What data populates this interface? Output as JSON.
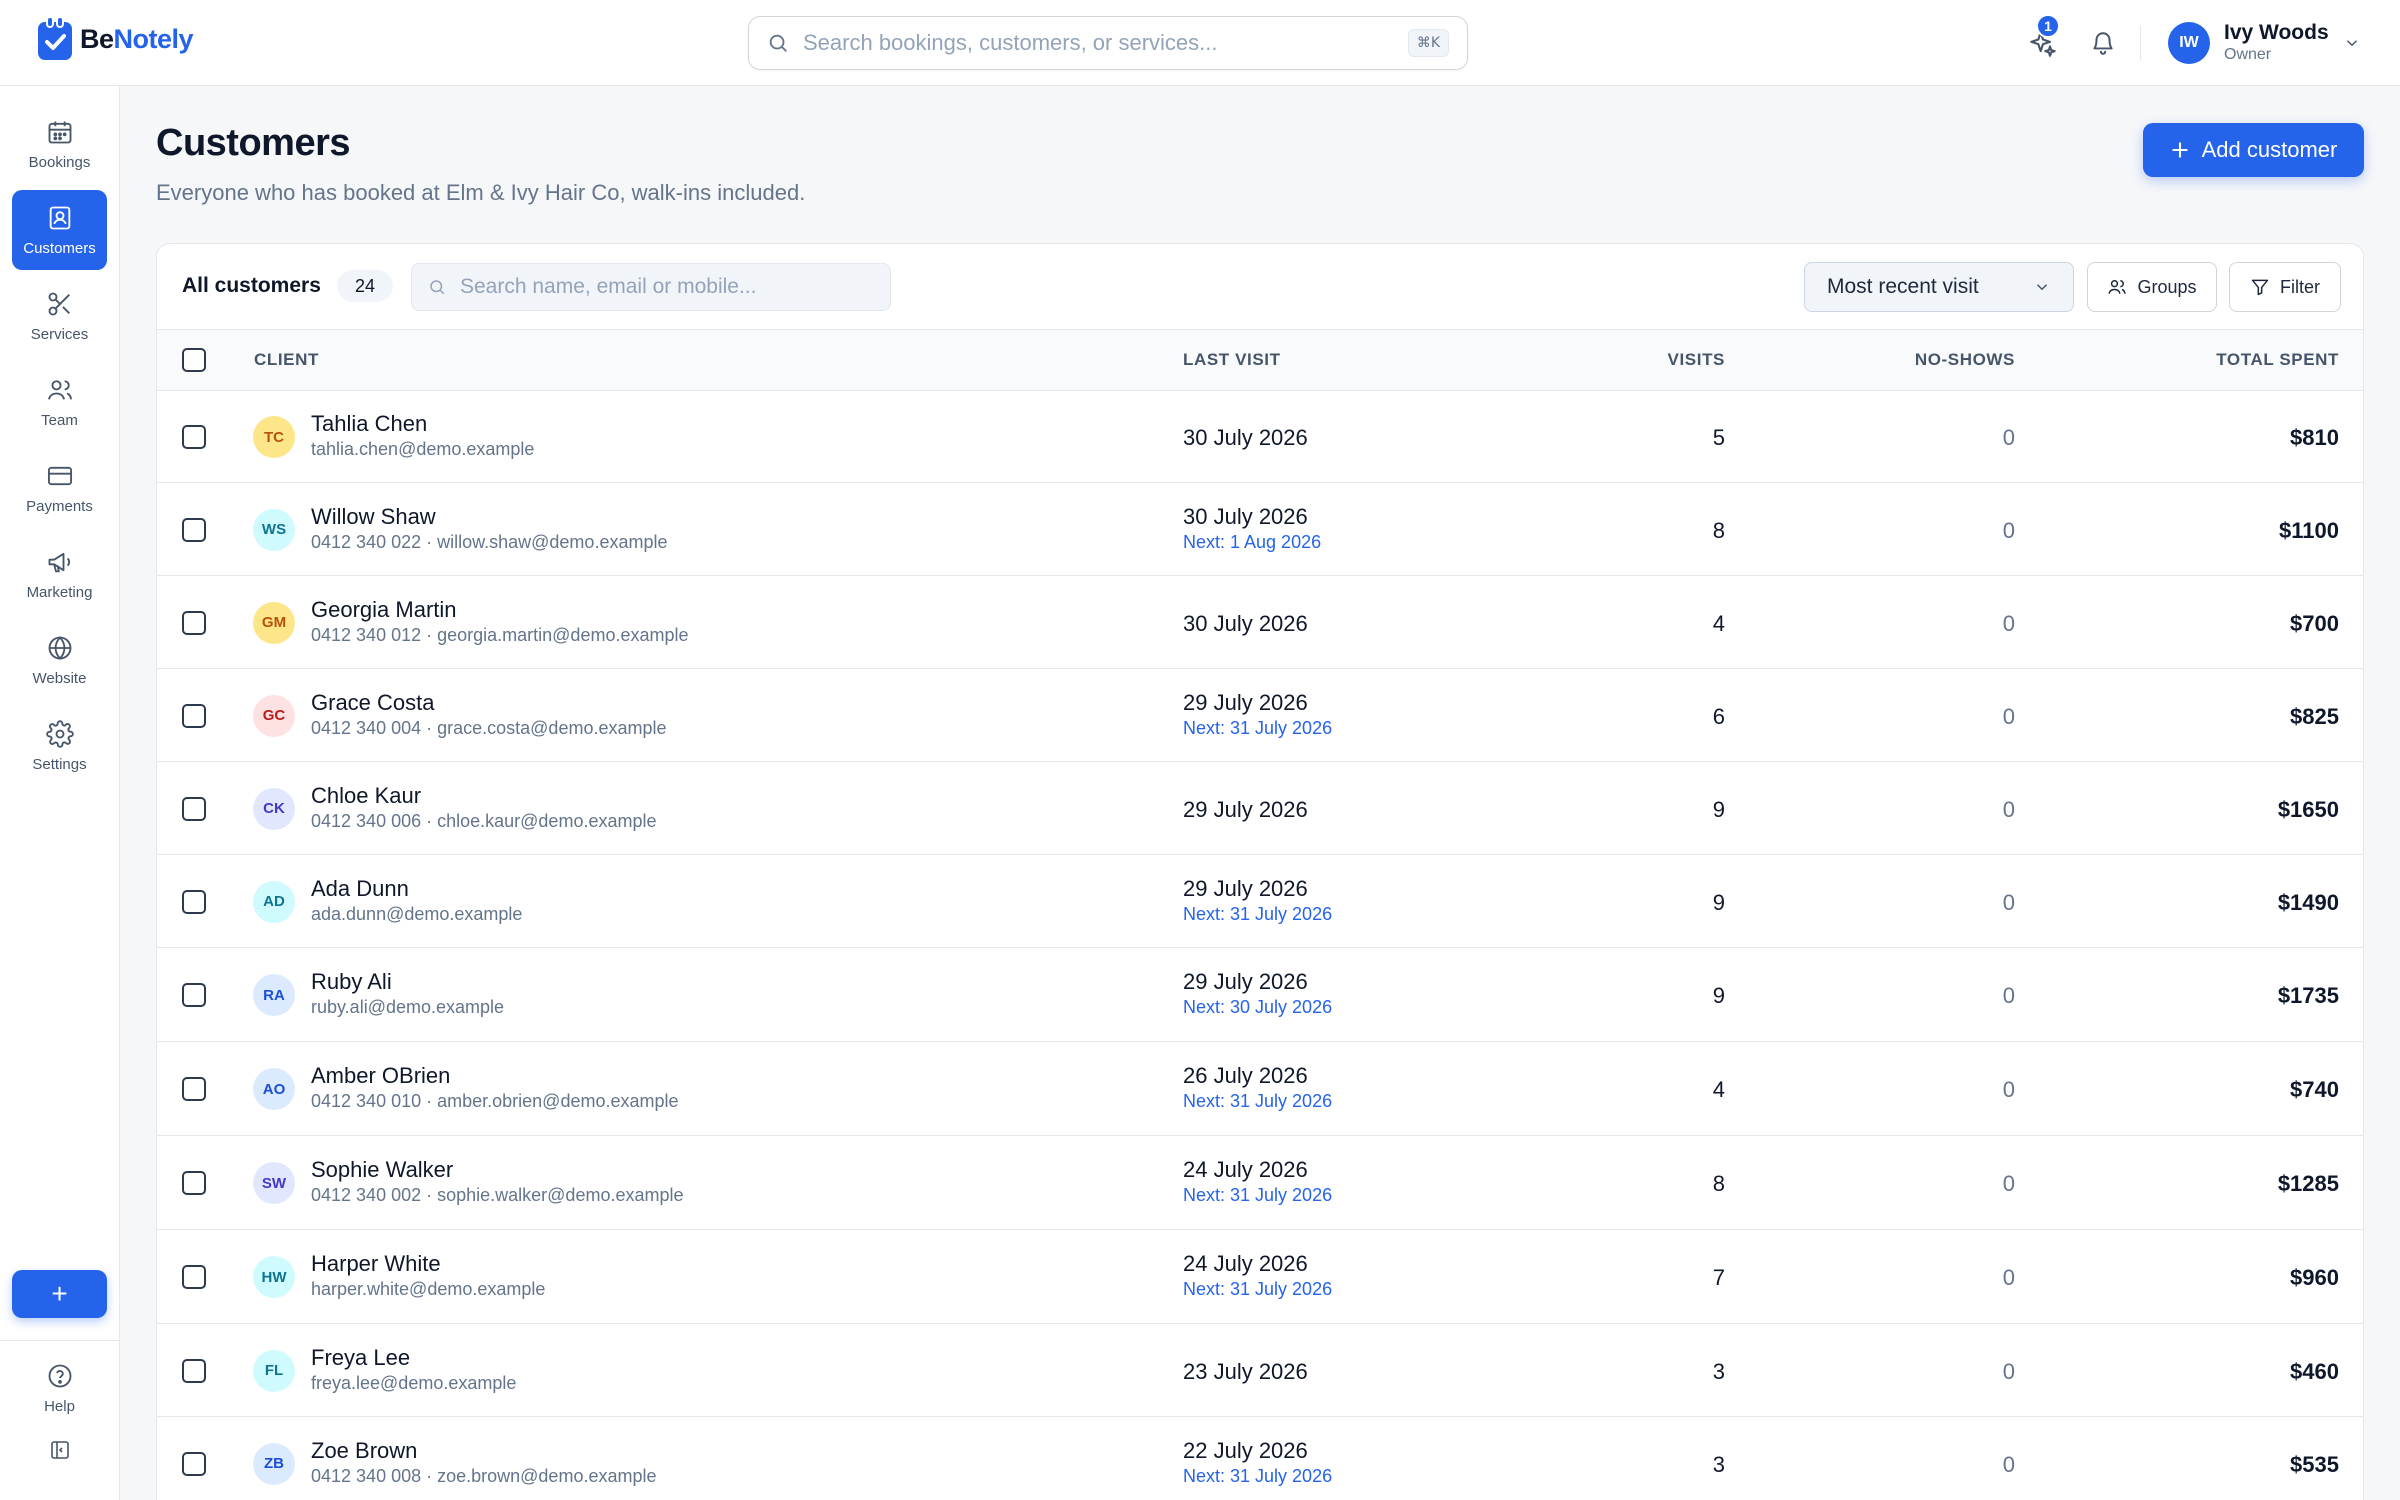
{
  "brand": {
    "name_part1": "Be",
    "name_part2": "Notely"
  },
  "search": {
    "placeholder": "Search bookings, customers, or services...",
    "shortcut": "⌘K"
  },
  "notifications": {
    "count": "1"
  },
  "user": {
    "initials": "IW",
    "name": "Ivy Woods",
    "role": "Owner"
  },
  "sidebar": {
    "items": [
      {
        "label": "Bookings",
        "icon": "calendar-icon"
      },
      {
        "label": "Customers",
        "icon": "contact-card-icon",
        "active": true
      },
      {
        "label": "Services",
        "icon": "scissors-icon"
      },
      {
        "label": "Team",
        "icon": "users-icon"
      },
      {
        "label": "Payments",
        "icon": "credit-card-icon"
      },
      {
        "label": "Marketing",
        "icon": "megaphone-icon"
      },
      {
        "label": "Website",
        "icon": "globe-icon"
      },
      {
        "label": "Settings",
        "icon": "gear-icon"
      }
    ],
    "fab_label": "+",
    "help_label": "Help"
  },
  "page": {
    "title": "Customers",
    "subtitle": "Everyone who has booked at Elm & Ivy Hair Co, walk-ins included.",
    "add_button": "Add customer"
  },
  "table_toolbar": {
    "all_label": "All customers",
    "count": "24",
    "search_placeholder": "Search name, email or mobile...",
    "sort_value": "Most recent visit",
    "groups_label": "Groups",
    "filter_label": "Filter"
  },
  "columns": {
    "client": "CLIENT",
    "last_visit": "LAST VISIT",
    "visits": "VISITS",
    "no_shows": "NO-SHOWS",
    "total_spent": "TOTAL SPENT"
  },
  "accent_color": "#2563eb",
  "customers": [
    {
      "initials": "TC",
      "name": "Tahlia Chen",
      "contact": "tahlia.chen@demo.example",
      "last_visit": "30 July 2026",
      "next": "",
      "visits": "5",
      "no_shows": "0",
      "total": "$810",
      "avatar_bg": "#fde68a",
      "avatar_fg": "#b45309"
    },
    {
      "initials": "WS",
      "name": "Willow Shaw",
      "contact": "0412 340 022 · willow.shaw@demo.example",
      "last_visit": "30 July 2026",
      "next": "Next: 1 Aug 2026",
      "visits": "8",
      "no_shows": "0",
      "total": "$1100",
      "avatar_bg": "#cffafe",
      "avatar_fg": "#0e7490"
    },
    {
      "initials": "GM",
      "name": "Georgia Martin",
      "contact": "0412 340 012 · georgia.martin@demo.example",
      "last_visit": "30 July 2026",
      "next": "",
      "visits": "4",
      "no_shows": "0",
      "total": "$700",
      "avatar_bg": "#fde68a",
      "avatar_fg": "#b45309"
    },
    {
      "initials": "GC",
      "name": "Grace Costa",
      "contact": "0412 340 004 · grace.costa@demo.example",
      "last_visit": "29 July 2026",
      "next": "Next: 31 July 2026",
      "visits": "6",
      "no_shows": "0",
      "total": "$825",
      "avatar_bg": "#fee2e2",
      "avatar_fg": "#b91c1c"
    },
    {
      "initials": "CK",
      "name": "Chloe Kaur",
      "contact": "0412 340 006 · chloe.kaur@demo.example",
      "last_visit": "29 July 2026",
      "next": "",
      "visits": "9",
      "no_shows": "0",
      "total": "$1650",
      "avatar_bg": "#e0e7ff",
      "avatar_fg": "#4338ca"
    },
    {
      "initials": "AD",
      "name": "Ada Dunn",
      "contact": "ada.dunn@demo.example",
      "last_visit": "29 July 2026",
      "next": "Next: 31 July 2026",
      "visits": "9",
      "no_shows": "0",
      "total": "$1490",
      "avatar_bg": "#cffafe",
      "avatar_fg": "#0e7490"
    },
    {
      "initials": "RA",
      "name": "Ruby Ali",
      "contact": "ruby.ali@demo.example",
      "last_visit": "29 July 2026",
      "next": "Next: 30 July 2026",
      "visits": "9",
      "no_shows": "0",
      "total": "$1735",
      "avatar_bg": "#dbeafe",
      "avatar_fg": "#1d4ed8"
    },
    {
      "initials": "AO",
      "name": "Amber OBrien",
      "contact": "0412 340 010 · amber.obrien@demo.example",
      "last_visit": "26 July 2026",
      "next": "Next: 31 July 2026",
      "visits": "4",
      "no_shows": "0",
      "total": "$740",
      "avatar_bg": "#dbeafe",
      "avatar_fg": "#1d4ed8"
    },
    {
      "initials": "SW",
      "name": "Sophie Walker",
      "contact": "0412 340 002 · sophie.walker@demo.example",
      "last_visit": "24 July 2026",
      "next": "Next: 31 July 2026",
      "visits": "8",
      "no_shows": "0",
      "total": "$1285",
      "avatar_bg": "#e0e7ff",
      "avatar_fg": "#4338ca"
    },
    {
      "initials": "HW",
      "name": "Harper White",
      "contact": "harper.white@demo.example",
      "last_visit": "24 July 2026",
      "next": "Next: 31 July 2026",
      "visits": "7",
      "no_shows": "0",
      "total": "$960",
      "avatar_bg": "#cffafe",
      "avatar_fg": "#0e7490"
    },
    {
      "initials": "FL",
      "name": "Freya Lee",
      "contact": "freya.lee@demo.example",
      "last_visit": "23 July 2026",
      "next": "",
      "visits": "3",
      "no_shows": "0",
      "total": "$460",
      "avatar_bg": "#cffafe",
      "avatar_fg": "#0e7490"
    },
    {
      "initials": "ZB",
      "name": "Zoe Brown",
      "contact": "0412 340 008 · zoe.brown@demo.example",
      "last_visit": "22 July 2026",
      "next": "Next: 31 July 2026",
      "visits": "3",
      "no_shows": "0",
      "total": "$535",
      "avatar_bg": "#dbeafe",
      "avatar_fg": "#1d4ed8"
    }
  ]
}
